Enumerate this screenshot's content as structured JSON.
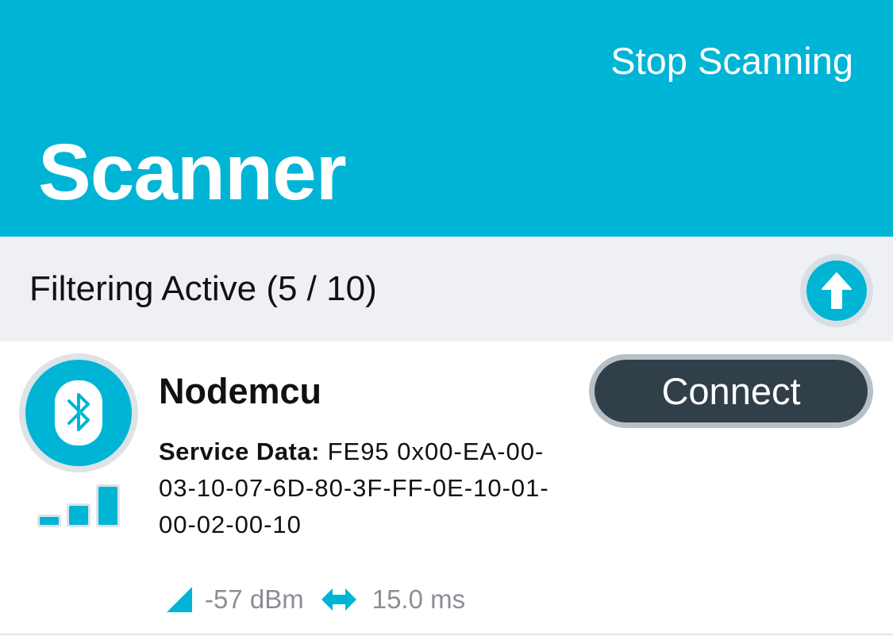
{
  "header": {
    "stop_label": "Stop Scanning",
    "title": "Scanner",
    "background_color": "#00b4d6"
  },
  "filter_bar": {
    "text": "Filtering Active (5 / 10)",
    "scroll_top_icon": "arrow-up-icon"
  },
  "devices": [
    {
      "name": "Nodemcu",
      "icon": "bluetooth-icon",
      "signal_level": "3 of 3 bars",
      "service_data_label": "Service Data:",
      "service_data_value": "FE95 0x00-EA-00-03-10-07-6D-80-3F-FF-0E-10-01-00-02-00-10",
      "connect_label": "Connect",
      "rssi": "-57 dBm",
      "interval": "15.0 ms"
    }
  ]
}
